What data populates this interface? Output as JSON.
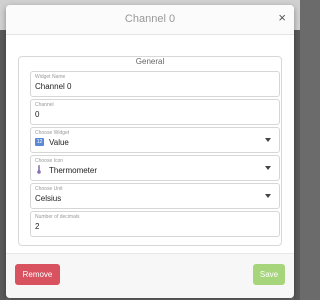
{
  "modal": {
    "title": "Channel 0"
  },
  "fieldset": {
    "legend": "General"
  },
  "fields": [
    {
      "label": "Widget Name",
      "value": "Channel 0"
    },
    {
      "label": "Channel",
      "value": "0"
    },
    {
      "label": "Choose Widget",
      "value": "Value",
      "icon": "value-widget-icon"
    },
    {
      "label": "Choose Icon",
      "value": "Thermometer",
      "icon": "thermometer-icon"
    },
    {
      "label": "Choose Unit",
      "value": "Celsius"
    },
    {
      "label": "Number of decimals",
      "value": "2"
    }
  ],
  "footer": {
    "remove_label": "Remove",
    "save_label": "Save"
  },
  "colors": {
    "remove": "#d85260",
    "save": "#a7d57b",
    "value_icon": "#5b8ad4"
  }
}
